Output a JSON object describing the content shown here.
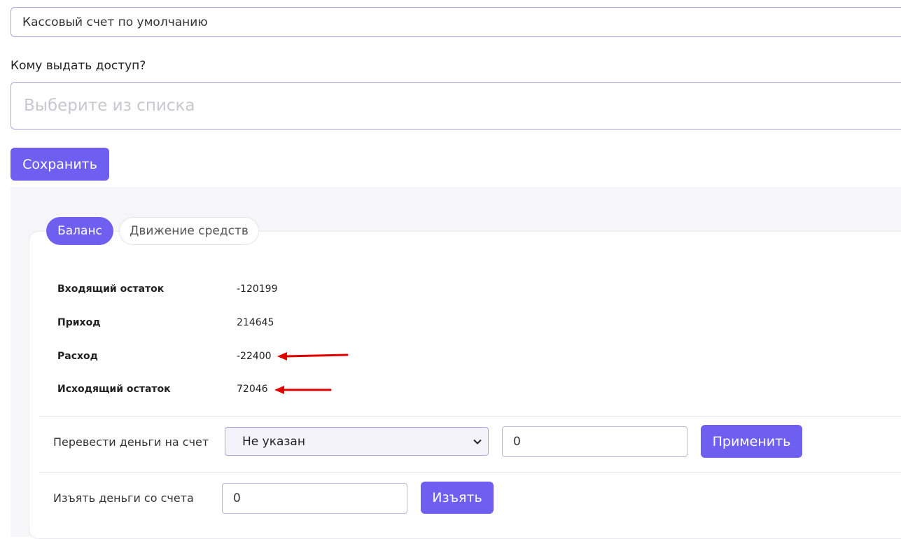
{
  "account": {
    "value": "Кассовый счет по умолчанию"
  },
  "access": {
    "label": "Кому выдать доступ?",
    "placeholder": "Выберите из списка"
  },
  "save_label": "Сохранить",
  "tabs": [
    {
      "label": "Баланс",
      "active": true
    },
    {
      "label": "Движение средств",
      "active": false
    }
  ],
  "balance": [
    {
      "label": "Входящий остаток",
      "value": "-120199"
    },
    {
      "label": "Приход",
      "value": "214645"
    },
    {
      "label": "Расход",
      "value": "-22400"
    },
    {
      "label": "Исходящий остаток",
      "value": "72046"
    }
  ],
  "transfer": {
    "label": "Перевести деньги на счет",
    "selected": "Не указан",
    "amount": "0",
    "button": "Применить"
  },
  "withdraw": {
    "label": "Изъять деньги со счета",
    "amount": "0",
    "button": "Изъять"
  },
  "colors": {
    "accent": "#6e5ff0",
    "annotation_arrow": "#e00000"
  },
  "icons": {
    "select_chevron": "chevron-down-icon"
  }
}
